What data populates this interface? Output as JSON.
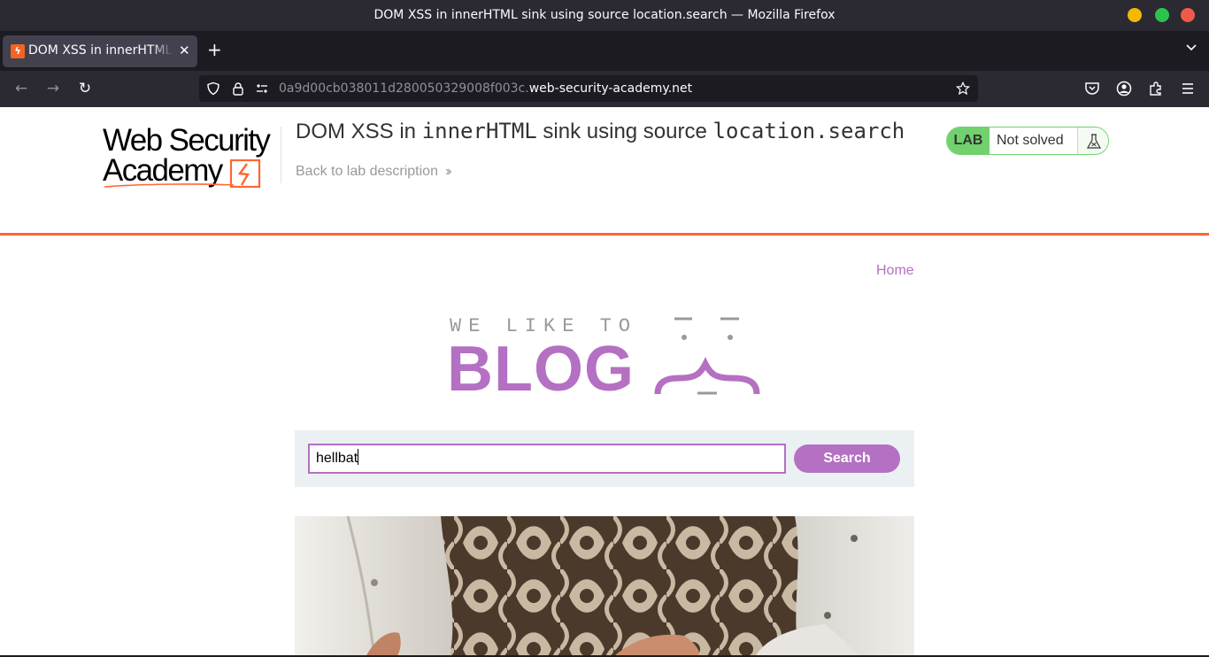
{
  "window": {
    "title": "DOM XSS in innerHTML sink using source location.search — Mozilla Firefox"
  },
  "tabs": [
    {
      "label": "DOM XSS in innerHTML sink using source location.search",
      "active": true
    }
  ],
  "toolbar": {
    "url_prefix": "0a9d00cb038011d280050329008f003c.",
    "url_domain": "web-security-academy.net"
  },
  "lab": {
    "logo_line1": "Web Security",
    "logo_line2": "Academy",
    "title_part1": "DOM XSS in ",
    "title_code1": "innerHTML",
    "title_part2": " sink using source ",
    "title_code2": "location.search",
    "back_link": "Back to lab description",
    "badge_label": "LAB",
    "status": "Not solved",
    "accent_color": "#ff6633",
    "status_color": "#70d16d"
  },
  "nav": {
    "home": "Home"
  },
  "banner": {
    "tagline": "WE LIKE TO",
    "headline": "BLOG",
    "accent_color": "#b470c2"
  },
  "search": {
    "value": "hellbat",
    "button_label": "Search"
  }
}
